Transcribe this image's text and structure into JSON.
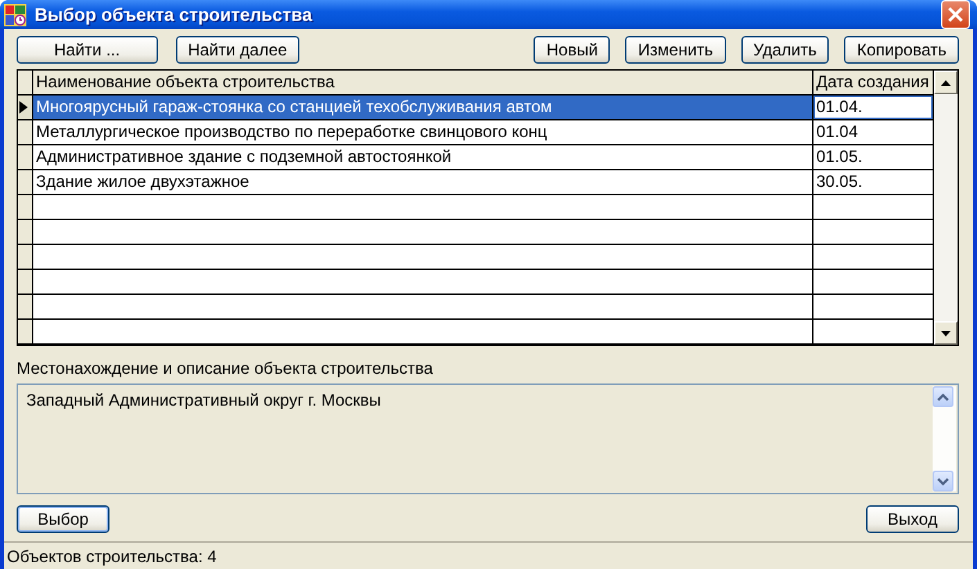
{
  "window": {
    "title": "Выбор объекта строительства"
  },
  "toolbar": {
    "left": [
      "Найти ...",
      "Найти далее"
    ],
    "right": [
      "Новый",
      "Изменить",
      "Удалить",
      "Копировать"
    ]
  },
  "table": {
    "columns": [
      "Наименование объекта строительства",
      "Дата создания"
    ],
    "rows": [
      {
        "name": "Многоярусный гараж-стоянка со станцией техобслуживания автом",
        "date": "01.04.",
        "selected": true,
        "current": true
      },
      {
        "name": "Металлургическое производство по переработке свинцового конц",
        "date": "01.04",
        "selected": false,
        "current": false
      },
      {
        "name": "Административное здание с подземной автостоянкой",
        "date": "01.05.",
        "selected": false,
        "current": false
      },
      {
        "name": "Здание жилое двухэтажное",
        "date": "30.05.",
        "selected": false,
        "current": false
      }
    ]
  },
  "description": {
    "label": "Местонахождение и описание объекта строительства",
    "value": "Западный Административный округ г. Москвы"
  },
  "buttons": {
    "left": "Выбор",
    "right": "Выход"
  },
  "status_bar": "Объектов строительства: 4"
}
